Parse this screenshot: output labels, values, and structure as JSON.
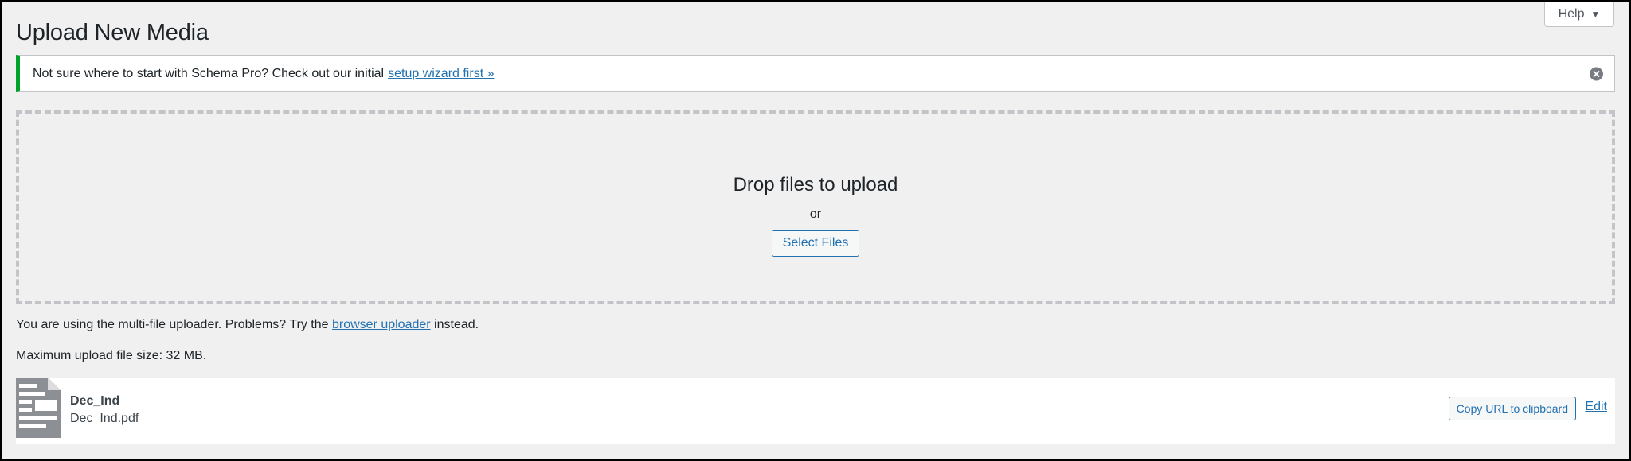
{
  "header": {
    "title": "Upload New Media",
    "help_label": "Help",
    "help_caret": "▼"
  },
  "notice": {
    "text": "Not sure where to start with Schema Pro? Check out our initial",
    "link_text": "setup wizard first »",
    "accent_color": "#00a32a",
    "dismiss_icon": "dismiss-icon"
  },
  "uploader": {
    "drop_title": "Drop files to upload",
    "or_text": "or",
    "select_button": "Select Files"
  },
  "info": {
    "multi_prefix": "You are using the multi-file uploader. Problems? Try the",
    "browser_link": "browser uploader",
    "multi_suffix": "instead.",
    "max_size": "Maximum upload file size: 32 MB."
  },
  "media_item": {
    "title": "Dec_Ind",
    "filename": "Dec_Ind.pdf",
    "icon": "document-icon",
    "copy_button": "Copy URL to clipboard",
    "edit_link": "Edit"
  },
  "colors": {
    "link": "#2271b1",
    "text": "#1d2327",
    "background": "#f0f0f1"
  }
}
